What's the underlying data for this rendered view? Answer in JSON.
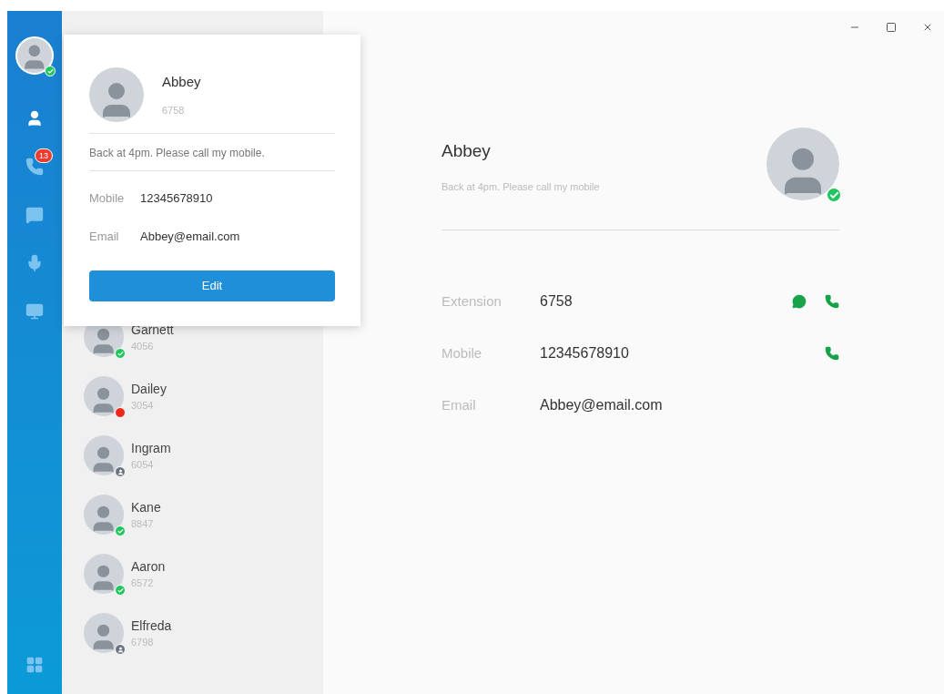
{
  "window": {
    "controls": [
      {
        "kind": "minimize"
      },
      {
        "kind": "maximize"
      },
      {
        "kind": "close"
      }
    ]
  },
  "sidebar": {
    "user_online": true,
    "items": [
      {
        "kind": "contacts",
        "selected": true
      },
      {
        "kind": "calls",
        "selected": false,
        "badge": "13"
      },
      {
        "kind": "chat",
        "selected": false
      },
      {
        "kind": "voicemail",
        "selected": false
      },
      {
        "kind": "conference",
        "selected": false
      }
    ],
    "bottom": {
      "kind": "apps"
    }
  },
  "popup": {
    "name": "Abbey",
    "extension": "6758",
    "status_message": "Back at 4pm. Please call my mobile.",
    "fields": [
      {
        "label": "Mobile",
        "value": "12345678910"
      },
      {
        "label": "Email",
        "value": "Abbey@email.com"
      }
    ],
    "button": "Edit"
  },
  "contacts": [
    {
      "name": "Garnett",
      "extension": "4056",
      "kind": "available"
    },
    {
      "name": "Dailey",
      "extension": "3054",
      "kind": "busy"
    },
    {
      "name": "Ingram",
      "extension": "6054",
      "kind": "offline"
    },
    {
      "name": "Kane",
      "extension": "8847",
      "kind": "available"
    },
    {
      "name": "Aaron",
      "extension": "6572",
      "kind": "available"
    },
    {
      "name": "Elfreda",
      "extension": "6798",
      "kind": "offline"
    }
  ],
  "detail": {
    "name": "Abbey",
    "status_message": "Back at 4pm. Please call my mobile",
    "online": true,
    "fields": [
      {
        "label": "Extension",
        "value": "6758",
        "can_message": true,
        "can_call": true
      },
      {
        "label": "Mobile",
        "value": "12345678910",
        "can_message": false,
        "can_call": true
      },
      {
        "label": "Email",
        "value": "Abbey@email.com",
        "can_message": false,
        "can_call": false
      }
    ]
  }
}
